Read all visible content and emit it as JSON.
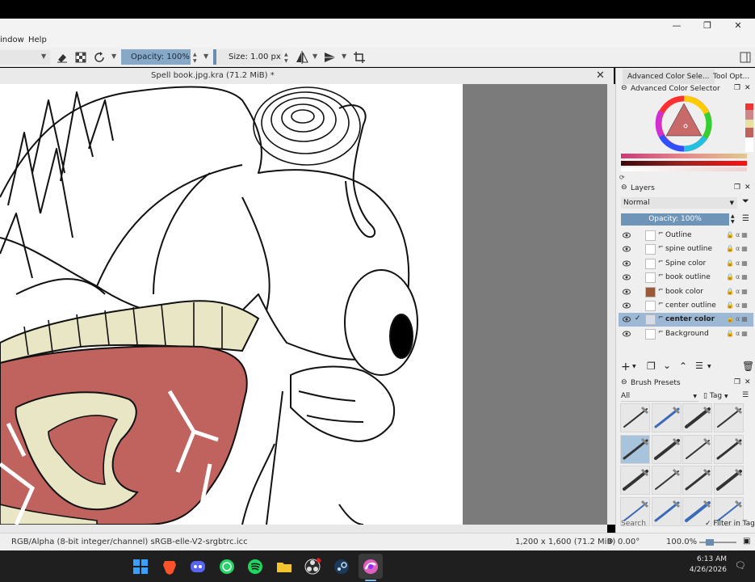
{
  "menu": {
    "window": "indow",
    "help": "Help"
  },
  "toolbar": {
    "opacity": "Opacity: 100%",
    "size": "Size: 1.00 px"
  },
  "document": {
    "title": "Spell book.jpg.kra (71.2 MiB) *",
    "close_glyph": "✕"
  },
  "window_controls": {
    "minimize": "—",
    "restore": "❐",
    "close": "✕"
  },
  "docker_tabs": [
    "Advanced Color Sele...",
    "Tool Opt..."
  ],
  "color_selector": {
    "title": "Advanced Color Selector"
  },
  "layers": {
    "title": "Layers",
    "blend_mode": "Normal",
    "opacity": "Opacity: 100%",
    "items": [
      {
        "name": "Outline",
        "active": false,
        "thumb": "#ffffff"
      },
      {
        "name": "spine outline",
        "active": false,
        "thumb": "#ffffff"
      },
      {
        "name": "Spine color",
        "active": false,
        "thumb": "#ffffff"
      },
      {
        "name": "book outline",
        "active": false,
        "thumb": "#ffffff"
      },
      {
        "name": "book color",
        "active": false,
        "thumb": "#9a5a3a"
      },
      {
        "name": "center outline",
        "active": false,
        "thumb": "#ffffff"
      },
      {
        "name": "center color",
        "active": true,
        "thumb": "#d8dce4"
      },
      {
        "name": "Background",
        "active": false,
        "thumb": "#ffffff"
      }
    ],
    "checkmark": "✓"
  },
  "brush_presets": {
    "title": "Brush Presets",
    "filter": "All",
    "tag": "Tag",
    "search_placeholder": "Search",
    "filter_in_tag": "Filter in Tag"
  },
  "status": {
    "color_space": "RGB/Alpha (8-bit integer/channel)  sRGB-elle-V2-srgbtrc.icc",
    "dimensions": "1,200 x 1,600 (71.2 MiB)",
    "rotation": "0.00°",
    "zoom": "100.0%"
  },
  "taskbar": {
    "time": "6:13 AM",
    "date": "4/26/2026"
  },
  "colors": {
    "accent": "#88a8c8",
    "active_layer": "#9cb8d4",
    "flesh": "#c0625e",
    "cream": "#e8e6c4"
  }
}
